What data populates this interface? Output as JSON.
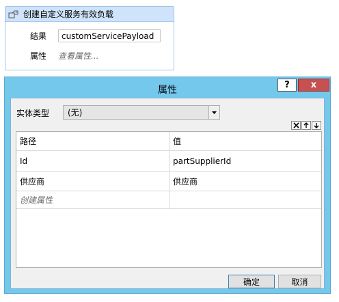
{
  "activity": {
    "title": "创建自定义服务有效负载",
    "icon": "service-payload-icon",
    "result_label": "结果",
    "result_value": "customServicePayload",
    "properties_label": "属性",
    "properties_link": "查看属性..."
  },
  "dialog": {
    "title": "属性",
    "help_label": "?",
    "close_label": "x",
    "entity_type_label": "实体类型",
    "entity_type_value": "(无)",
    "toolbar_icons": [
      "delete-icon",
      "move-up-icon",
      "move-down-icon"
    ],
    "grid": {
      "columns": [
        "路径",
        "值"
      ],
      "rows": [
        {
          "path": "Id",
          "value": "partSupplierId"
        },
        {
          "path": "供应商",
          "value": "供应商"
        }
      ],
      "create_placeholder": "创建属性"
    },
    "ok_label": "确定",
    "cancel_label": "取消"
  },
  "colors": {
    "dialog_frame": "#74c8ec",
    "close_button": "#c75050",
    "activity_header": "#cfe3fa"
  }
}
